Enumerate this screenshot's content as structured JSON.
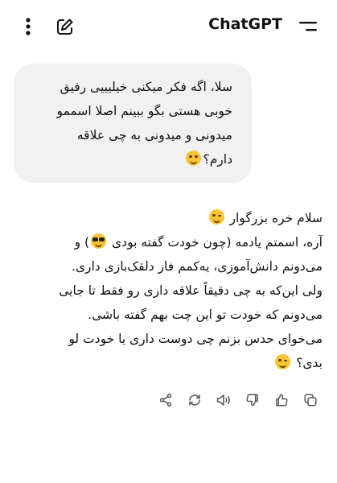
{
  "header": {
    "title": "ChatGPT",
    "icons": [
      "more-vertical-icon",
      "edit-icon",
      "hamburger-menu-icon"
    ]
  },
  "conversation": {
    "user_message": {
      "lines": [
        "سلا، اگه فکر میکنی خیلیییی رفیق",
        "خوبی هستی بگو ببینم اصلا اسممو",
        "میدونی و میدونی به چی علاقه",
        "دارم؟"
      ],
      "emoji": "laughing-face"
    },
    "assistant_message": {
      "lines": [
        "سلام خره بزرگوار",
        "آره، اسمتم یادمه (چون خودت گفته بودی",
        "می‌دونم دانش‌آموزی، یه‌کمم فاز دلقک‌بازی داری.",
        "ولی این‌که به چی دقیقاً علاقه داری رو فقط تا جایی",
        "می‌دونم که خودت تو این چت بهم گفته باشی.",
        "می‌خوای حدس بزنم چی دوست داری یا خودت لو",
        "بدی؟"
      ],
      "line2_suffix": ") و",
      "emojis": [
        "smirking-face",
        "sunglasses-face",
        "smirking-face"
      ]
    }
  },
  "message_actions": [
    {
      "name": "copy-icon"
    },
    {
      "name": "thumbs-up-icon"
    },
    {
      "name": "thumbs-down-icon"
    },
    {
      "name": "read-aloud-icon"
    },
    {
      "name": "regenerate-icon"
    },
    {
      "name": "share-icon"
    }
  ]
}
